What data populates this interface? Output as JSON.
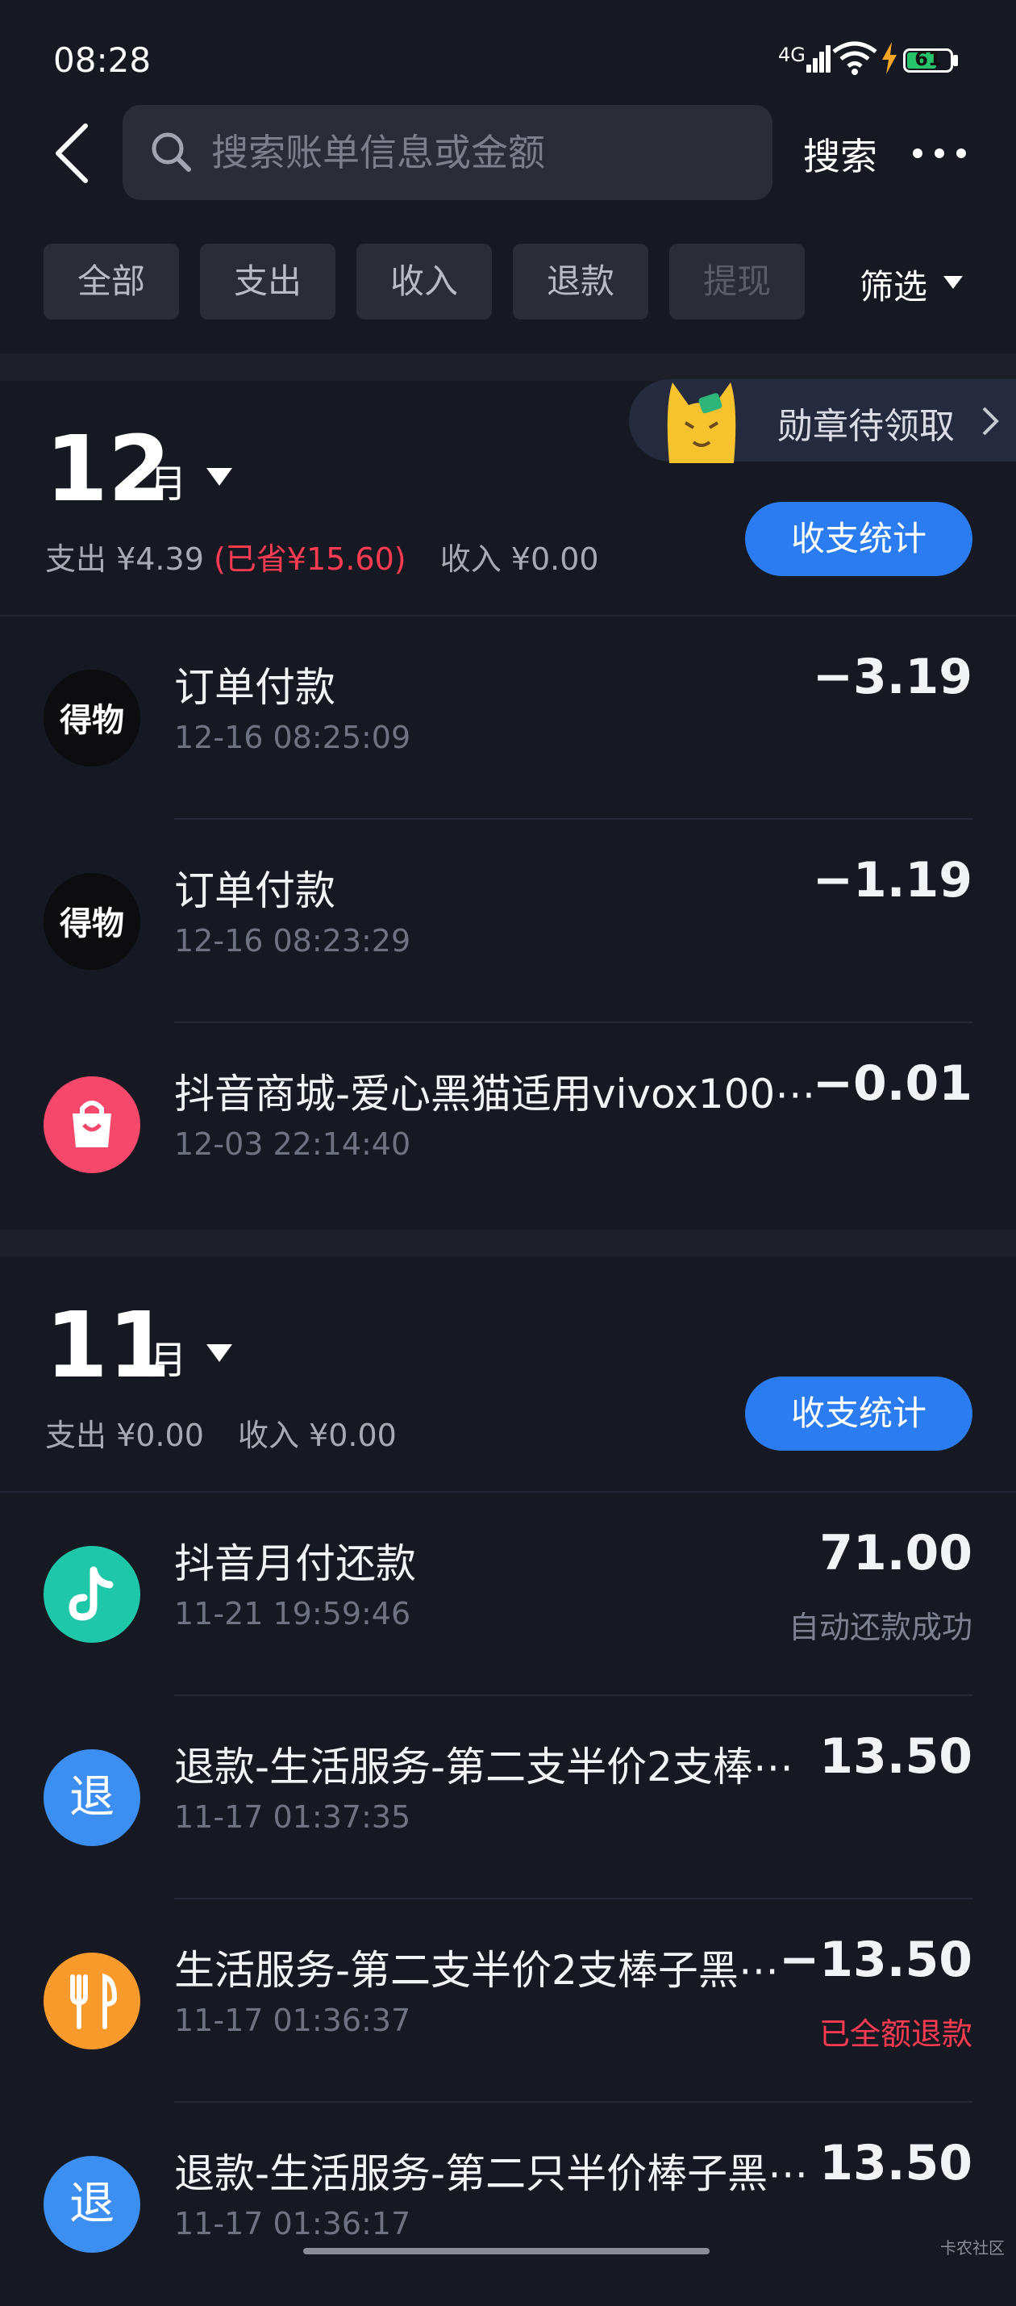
{
  "status_bar": {
    "time": "08:28",
    "network": "4G",
    "battery": "61"
  },
  "header": {
    "search_placeholder": "搜索账单信息或金额",
    "search_button": "搜索"
  },
  "tabs": [
    "全部",
    "支出",
    "收入",
    "退款",
    "提现"
  ],
  "filter_label": "筛选",
  "badge": {
    "text": "勋章待领取"
  },
  "months": [
    {
      "month": "12",
      "unit": "月",
      "spend": "支出 ¥4.39",
      "saved": "(已省¥15.60)",
      "income": "收入 ¥0.00",
      "stat_button": "收支统计",
      "rows": [
        {
          "icon": "dewu-icon",
          "title": "订单付款",
          "time": "12-16 08:25:09",
          "amount": "−3.19",
          "sub": ""
        },
        {
          "icon": "dewu-icon",
          "title": "订单付款",
          "time": "12-16 08:23:29",
          "amount": "−1.19",
          "sub": ""
        },
        {
          "icon": "shopping-bag-icon",
          "title": "抖音商城-爱心黑猫适用vivox100⋯",
          "time": "12-03 22:14:40",
          "amount": "−0.01",
          "sub": ""
        }
      ]
    },
    {
      "month": "11",
      "unit": "月",
      "spend": "支出 ¥0.00",
      "saved": "",
      "income": "收入 ¥0.00",
      "stat_button": "收支统计",
      "rows": [
        {
          "icon": "tiktok-icon",
          "title": "抖音月付还款",
          "time": "11-21 19:59:46",
          "amount": "71.00",
          "sub": "自动还款成功"
        },
        {
          "icon": "refund-icon",
          "title": "退款-生活服务-第二支半价2支棒⋯",
          "time": "11-17 01:37:35",
          "amount": "13.50",
          "sub": ""
        },
        {
          "icon": "food-icon",
          "title": "生活服务-第二支半价2支棒子黑⋯",
          "time": "11-17 01:36:37",
          "amount": "−13.50",
          "sub": "已全额退款"
        },
        {
          "icon": "refund-icon",
          "title": "退款-生活服务-第二只半价棒子黑⋯",
          "time": "11-17 01:36:17",
          "amount": "13.50",
          "sub": ""
        }
      ]
    }
  ],
  "icon_text": {
    "dewu": "得物",
    "refund": "退"
  },
  "watermark": "卡农社区",
  "colors": {
    "background": "#161822",
    "accent": "#2b7cf0",
    "negative": "#ff3b52"
  }
}
